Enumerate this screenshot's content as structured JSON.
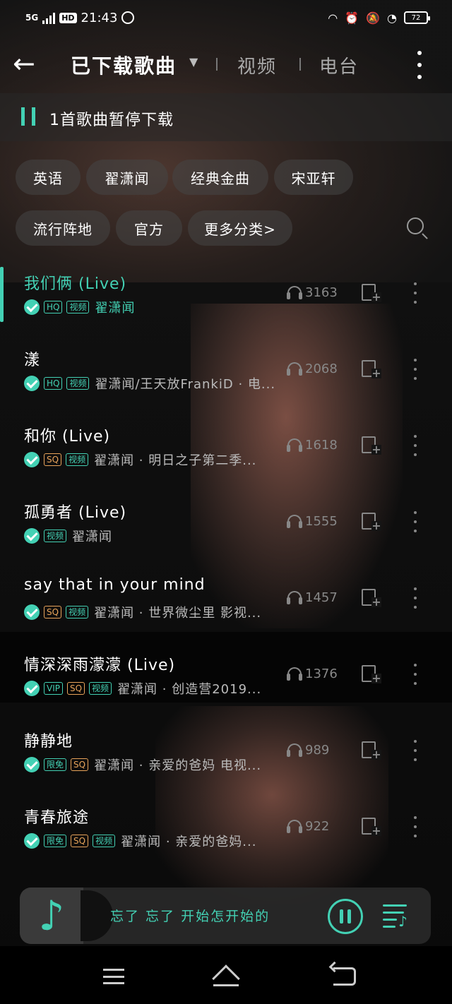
{
  "status_bar": {
    "network": "5G",
    "hd": "HD",
    "time": "21:43",
    "battery": "72"
  },
  "header": {
    "back_icon": "arrow-left-icon",
    "tabs": [
      {
        "label": "已下载歌曲",
        "active": true
      },
      {
        "label": "视频",
        "active": false
      },
      {
        "label": "电台",
        "active": false
      }
    ]
  },
  "paused_banner": {
    "text": "1首歌曲暂停下载"
  },
  "categories": [
    {
      "label": "英语"
    },
    {
      "label": "翟潇闻"
    },
    {
      "label": "经典金曲"
    },
    {
      "label": "宋亚轩"
    },
    {
      "label": "流行阵地"
    },
    {
      "label": "官方"
    },
    {
      "label": "更多分类>"
    }
  ],
  "songs": [
    {
      "title": "我们俩 (Live)",
      "badges": [
        "HQ",
        "视频"
      ],
      "artist": "翟潇闻",
      "plays": "3163",
      "active": true
    },
    {
      "title": "漾",
      "badges": [
        "HQ",
        "视频"
      ],
      "artist": "翟潇闻/王天放FrankiD · 电...",
      "plays": "2068",
      "active": false
    },
    {
      "title": "和你 (Live)",
      "badges": [
        "SQ",
        "视频"
      ],
      "artist": "翟潇闻 · 明日之子第二季...",
      "plays": "1618",
      "active": false
    },
    {
      "title": "孤勇者 (Live)",
      "badges": [
        "视频"
      ],
      "artist": "翟潇闻",
      "plays": "1555",
      "active": false
    },
    {
      "title": "say that in your mind",
      "badges": [
        "SQ",
        "视频"
      ],
      "artist": "翟潇闻 · 世界微尘里 影视...",
      "plays": "1457",
      "active": false
    },
    {
      "title": "情深深雨濛濛 (Live)",
      "badges": [
        "VIP",
        "SQ",
        "视频"
      ],
      "artist": "翟潇闻 · 创造营2019...",
      "plays": "1376",
      "active": false
    },
    {
      "title": "静静地",
      "badges": [
        "限免",
        "SQ"
      ],
      "artist": "翟潇闻 · 亲爱的爸妈 电视...",
      "plays": "989",
      "active": false
    },
    {
      "title": "青春旅途",
      "badges": [
        "限免",
        "SQ",
        "视频"
      ],
      "artist": "翟潇闻 · 亲爱的爸妈...",
      "plays": "922",
      "active": false
    }
  ],
  "player": {
    "now_playing": "忘了 忘了 开始怎开始的",
    "cover_icon": "music-note-icon"
  },
  "colors": {
    "accent": "#43d1b4",
    "sq_badge": "#e8a35a"
  }
}
